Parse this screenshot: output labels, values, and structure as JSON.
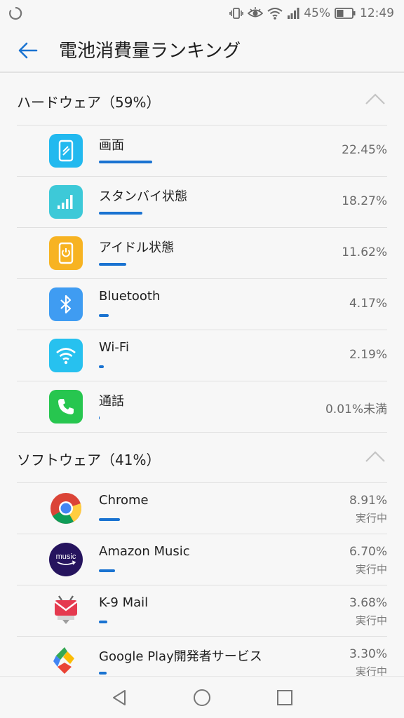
{
  "status_bar": {
    "battery_percent": "45%",
    "battery_level": 0.45,
    "time": "12:49"
  },
  "app_bar": {
    "title": "電池消費量ランキング"
  },
  "hardware": {
    "header": "ハードウェア（59%）",
    "items": [
      {
        "name": "画面",
        "percent": "22.45%",
        "value": 22.45,
        "icon": "screen-icon",
        "color": "#22b9ef"
      },
      {
        "name": "スタンバイ状態",
        "percent": "18.27%",
        "value": 18.27,
        "icon": "signal-icon",
        "color": "#3dc9d8"
      },
      {
        "name": "アイドル状態",
        "percent": "11.62%",
        "value": 11.62,
        "icon": "power-icon",
        "color": "#f7b322"
      },
      {
        "name": "Bluetooth",
        "percent": "4.17%",
        "value": 4.17,
        "icon": "bluetooth-icon",
        "color": "#3f9cf2"
      },
      {
        "name": "Wi-Fi",
        "percent": "2.19%",
        "value": 2.19,
        "icon": "wifi-icon",
        "color": "#27c1ef"
      },
      {
        "name": "通話",
        "percent": "0.01%未満",
        "value": 0.01,
        "icon": "phone-icon",
        "color": "#27c64f"
      }
    ]
  },
  "software": {
    "header": "ソフトウェア（41%）",
    "items": [
      {
        "name": "Chrome",
        "percent": "8.91%",
        "value": 8.91,
        "status": "実行中",
        "icon": "chrome-icon"
      },
      {
        "name": "Amazon Music",
        "percent": "6.70%",
        "value": 6.7,
        "status": "実行中",
        "icon": "amazon-music-icon",
        "logo_text": "music"
      },
      {
        "name": "K-9 Mail",
        "percent": "3.68%",
        "value": 3.68,
        "status": "実行中",
        "icon": "k9-mail-icon"
      },
      {
        "name": "Google Play開発者サービス",
        "percent": "3.30%",
        "value": 3.3,
        "status": "実行中",
        "icon": "google-play-services-icon"
      }
    ]
  },
  "accent_color": "#1a73d1"
}
